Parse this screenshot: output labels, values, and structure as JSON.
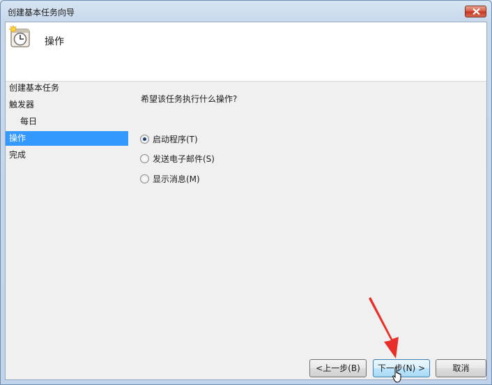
{
  "window": {
    "title": "创建基本任务向导"
  },
  "header": {
    "title": "操作",
    "icon": "task-scheduler-clock-icon"
  },
  "nav": {
    "items": [
      {
        "label": "创建基本任务",
        "active": false
      },
      {
        "label": "触发器",
        "active": false
      },
      {
        "label": "每日",
        "active": false
      },
      {
        "label": "操作",
        "active": true
      },
      {
        "label": "完成",
        "active": false
      }
    ]
  },
  "main": {
    "question": "希望该任务执行什么操作?",
    "options": [
      {
        "label": "启动程序(T)",
        "selected": true
      },
      {
        "label": "发送电子邮件(S)",
        "selected": false
      },
      {
        "label": "显示消息(M)",
        "selected": false
      }
    ]
  },
  "buttons": {
    "back": "<上一步(B)",
    "next": "下一步(N) >",
    "cancel": "取消"
  },
  "colors": {
    "selection": "#3399ff",
    "annotation_arrow": "#e8302a"
  }
}
